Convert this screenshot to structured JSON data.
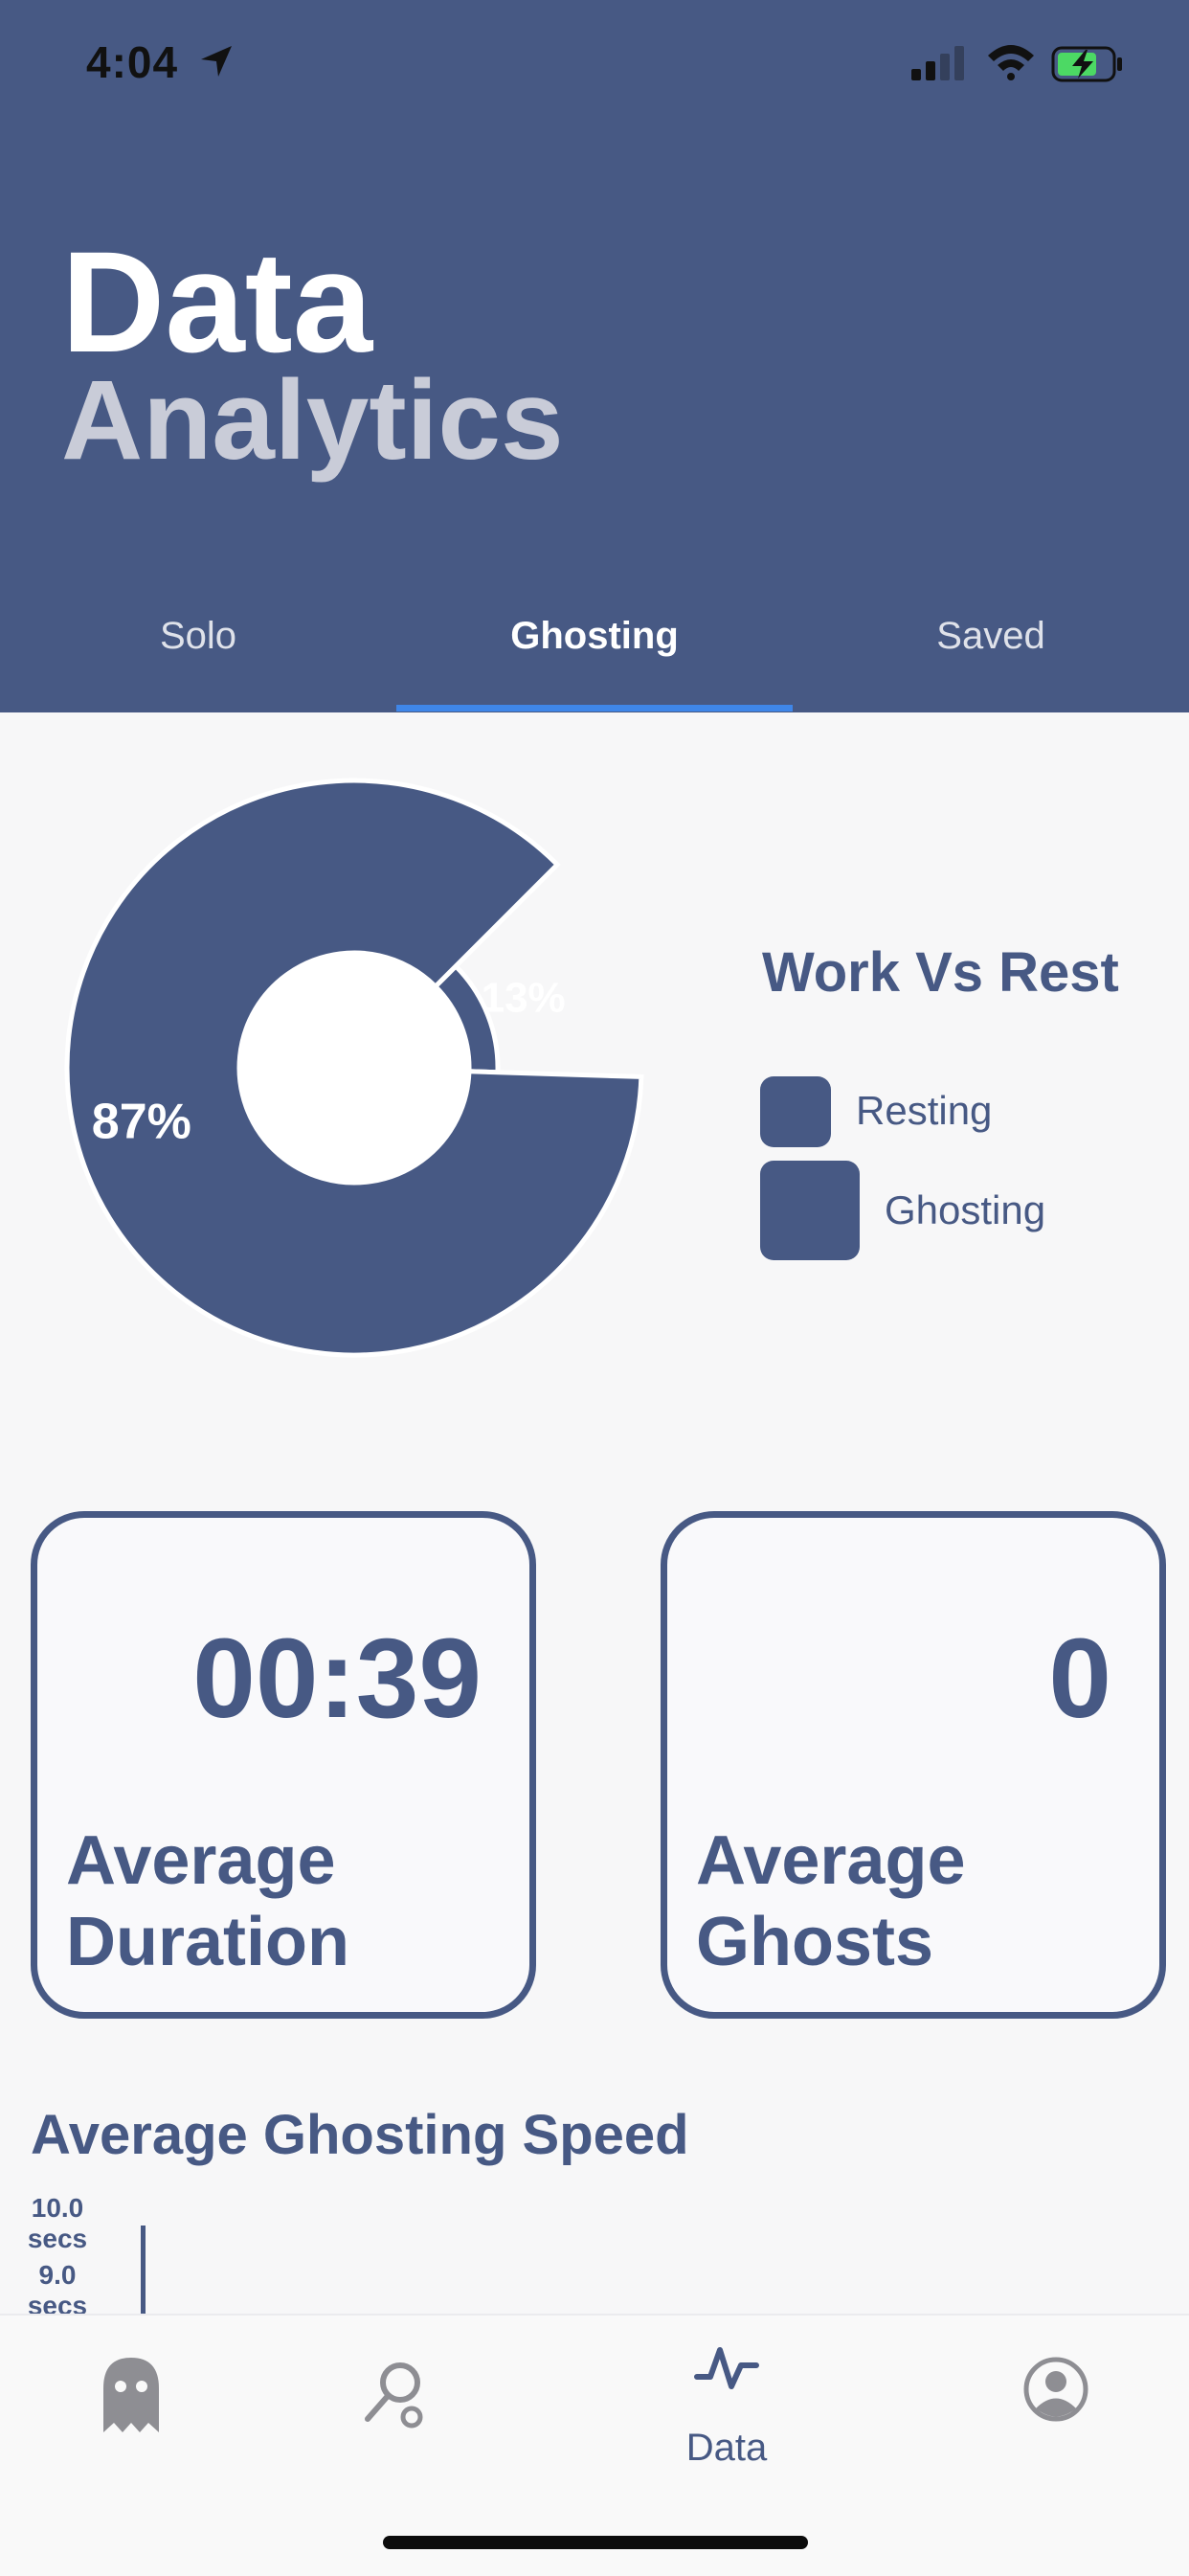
{
  "status_bar": {
    "time": "4:04"
  },
  "header": {
    "title_line1": "Data",
    "title_line2": "Analytics"
  },
  "tabs": [
    {
      "label": "Solo",
      "active": false
    },
    {
      "label": "Ghosting",
      "active": true
    },
    {
      "label": "Saved",
      "active": false
    }
  ],
  "chart_data": {
    "type": "pie",
    "style": "donut",
    "title": "Work Vs Rest",
    "slices": [
      {
        "label": "Resting",
        "value": 13,
        "display": "13%"
      },
      {
        "label": "Ghosting",
        "value": 87,
        "display": "87%"
      }
    ],
    "colors": {
      "slice": "#475984",
      "separator": "#ffffff"
    }
  },
  "legend": {
    "title": "Work Vs Rest",
    "items": [
      "Resting",
      "Ghosting"
    ]
  },
  "cards": [
    {
      "value": "00:39",
      "label": "Average Duration"
    },
    {
      "value": "0",
      "label": "Average Ghosts"
    }
  ],
  "speed_chart": {
    "title": "Average Ghosting Speed",
    "y_ticks": [
      "10.0 secs",
      "9.0 secs"
    ]
  },
  "bottom_nav": [
    {
      "icon": "ghost-icon",
      "label": ""
    },
    {
      "icon": "search-icon",
      "label": ""
    },
    {
      "icon": "pulse-icon",
      "label": "Data"
    },
    {
      "icon": "profile-icon",
      "label": ""
    }
  ],
  "colors": {
    "primary": "#475984",
    "accent": "#3f86e8",
    "background": "#f7f7f8"
  }
}
